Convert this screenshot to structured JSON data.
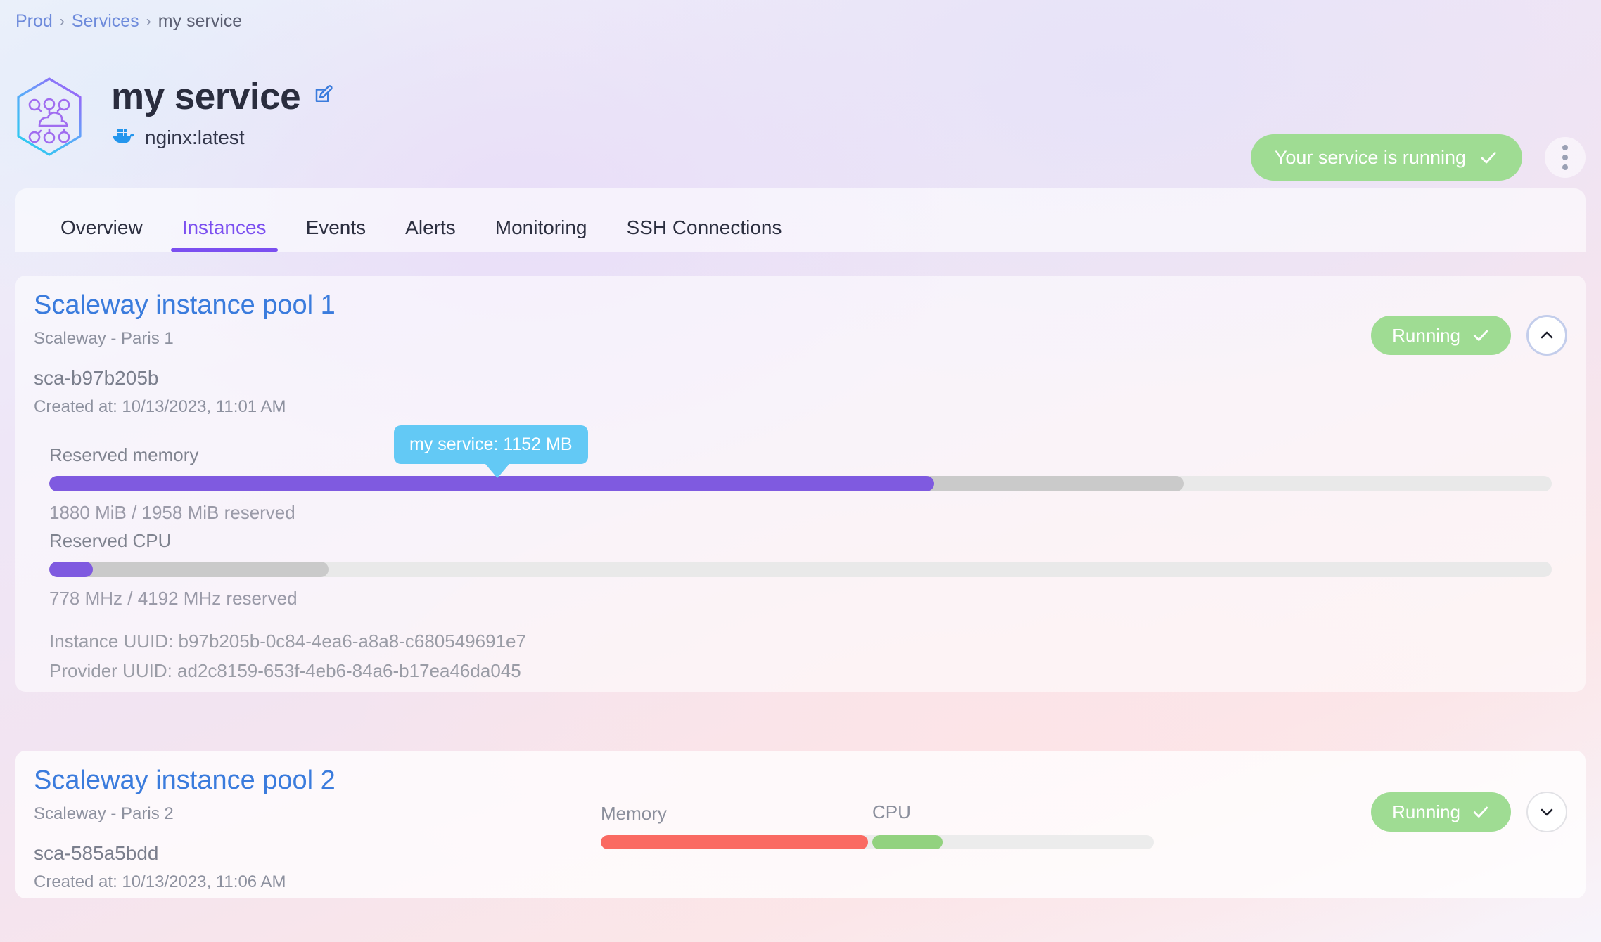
{
  "breadcrumb": {
    "items": [
      {
        "label": "Prod",
        "type": "link"
      },
      {
        "label": "Services",
        "type": "link"
      },
      {
        "label": "my service",
        "type": "current"
      }
    ],
    "separator": "›"
  },
  "header": {
    "logo_icon": "cloud-network-hexagon-icon",
    "title": "my service",
    "edit_icon": "edit-pencil-icon",
    "registry_icon": "docker-whale-icon",
    "image": "nginx:latest",
    "status": {
      "label": "Your service is running",
      "icon": "check-icon",
      "color": "#9fdc93"
    },
    "more_menu_icon": "kebab-menu-icon"
  },
  "tabs": [
    {
      "label": "Overview",
      "active": false
    },
    {
      "label": "Instances",
      "active": true
    },
    {
      "label": "Events",
      "active": false
    },
    {
      "label": "Alerts",
      "active": false
    },
    {
      "label": "Monitoring",
      "active": false
    },
    {
      "label": "SSH Connections",
      "active": false
    }
  ],
  "tab_accent_color": "#7b4ff0",
  "tooltip": {
    "text": "my service: 1152 MB",
    "color": "#63c9f5"
  },
  "pools": [
    {
      "title": "Scaleway instance pool 1",
      "subtitle": "Scaleway - Paris 1",
      "id": "sca-b97b205b",
      "created": "Created at: 10/13/2023, 11:01 AM",
      "status": {
        "label": "Running",
        "icon": "check-icon",
        "color": "#9fdc93"
      },
      "toggle_icon": "chevron-up-icon",
      "expanded": true,
      "memory": {
        "label": "Reserved memory",
        "caption": "1880 MiB / 1958 MiB reserved",
        "used_pct": 58.9,
        "reserved_pct": 75.5,
        "fill_color": "#7f5ae0",
        "secondary_color": "#cacaca",
        "track_color": "#e9e9e9"
      },
      "cpu": {
        "label": "Reserved CPU",
        "caption": "778 MHz / 4192 MHz reserved",
        "used_pct": 2.9,
        "reserved_pct": 18.6,
        "fill_color": "#7f5ae0",
        "secondary_color": "#cacaca",
        "track_color": "#e9e9e9"
      },
      "instance_uuid": "Instance UUID: b97b205b-0c84-4ea6-a8a8-c680549691e7",
      "provider_uuid": "Provider UUID: ad2c8159-653f-4eb6-84a6-b17ea46da045"
    },
    {
      "title": "Scaleway instance pool 2",
      "subtitle": "Scaleway - Paris 2",
      "id": "sca-585a5bdd",
      "created": "Created at: 10/13/2023, 11:06 AM",
      "status": {
        "label": "Running",
        "icon": "check-icon",
        "color": "#9fdc93"
      },
      "toggle_icon": "chevron-down-icon",
      "expanded": false,
      "mini_memory": {
        "label": "Memory",
        "pct": 95,
        "fill_color": "#fa6a62",
        "track_color": "#ececec"
      },
      "mini_cpu": {
        "label": "CPU",
        "pct": 25,
        "fill_color": "#92d27f",
        "track_color": "#ececec"
      }
    }
  ]
}
